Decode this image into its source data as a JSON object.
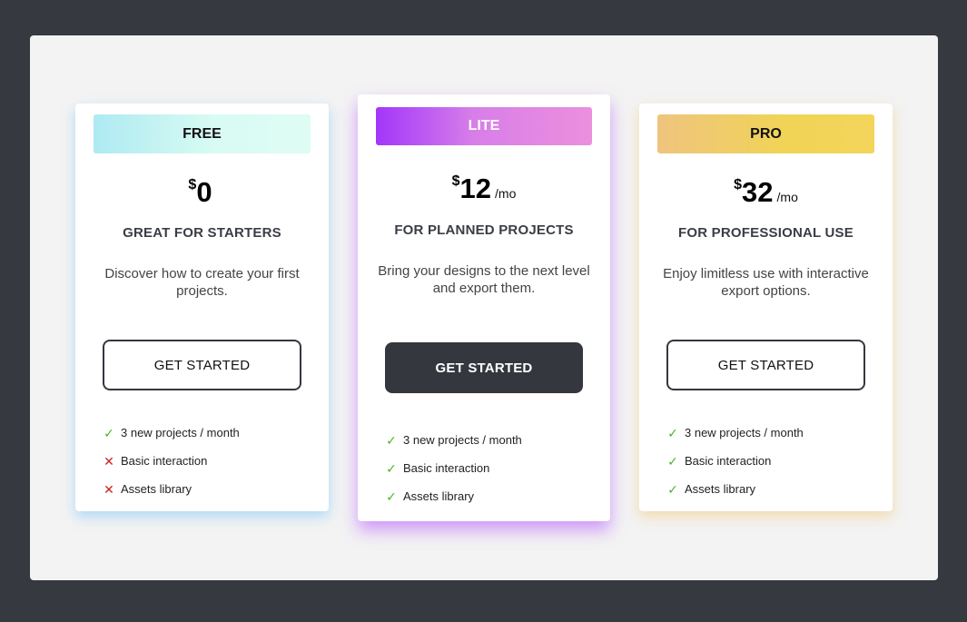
{
  "plans": [
    {
      "id": "free",
      "tier": "FREE",
      "currency": "$",
      "amount": "0",
      "period": "",
      "headline": "GREAT FOR STARTERS",
      "description": "Discover how to create your first projects.",
      "cta": "GET STARTED",
      "features": [
        {
          "label": "3 new projects / month",
          "included": true,
          "icon": "check-icon"
        },
        {
          "label": "Basic interaction",
          "included": false,
          "icon": "cross-icon"
        },
        {
          "label": "Assets library",
          "included": false,
          "icon": "cross-icon"
        }
      ]
    },
    {
      "id": "lite",
      "tier": "LITE",
      "currency": "$",
      "amount": "12",
      "period": "/mo",
      "headline": "FOR PLANNED PROJECTS",
      "description": "Bring your designs to the next level and export them.",
      "cta": "GET STARTED",
      "features": [
        {
          "label": "3 new projects / month",
          "included": true,
          "icon": "check-icon"
        },
        {
          "label": "Basic interaction",
          "included": true,
          "icon": "check-icon"
        },
        {
          "label": "Assets library",
          "included": true,
          "icon": "check-icon"
        }
      ]
    },
    {
      "id": "pro",
      "tier": "PRO",
      "currency": "$",
      "amount": "32",
      "period": "/mo",
      "headline": "FOR PROFESSIONAL USE",
      "description": "Enjoy limitless use with interactive export options.",
      "cta": "GET STARTED",
      "features": [
        {
          "label": "3 new projects / month",
          "included": true,
          "icon": "check-icon"
        },
        {
          "label": "Basic interaction",
          "included": true,
          "icon": "check-icon"
        },
        {
          "label": "Assets library",
          "included": true,
          "icon": "check-icon"
        }
      ]
    }
  ],
  "colors": {
    "page_background": "#363940",
    "panel_background": "#f3f3f3",
    "primary_button": "#34373e",
    "check": "#4ab52a",
    "cross": "#cc2222",
    "free_gradient": [
      "#aeeaf2",
      "#defcf4"
    ],
    "lite_gradient": [
      "#a236fa",
      "#ec8fdd"
    ],
    "pro_gradient": [
      "#efc47e",
      "#f2d55a"
    ]
  }
}
